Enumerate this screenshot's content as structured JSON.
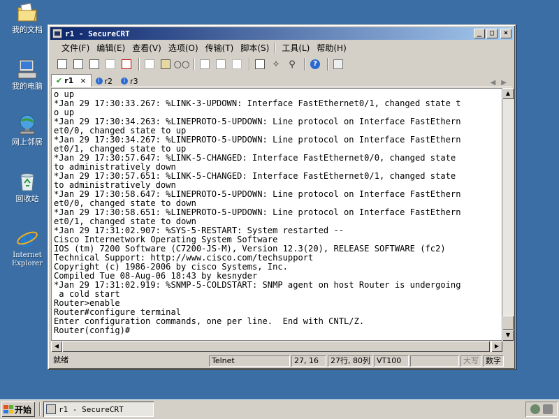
{
  "desktop": {
    "icons": [
      {
        "label": "我的文档",
        "icon": "my-documents-folder-icon"
      },
      {
        "label": "我的电脑",
        "icon": "my-computer-icon"
      },
      {
        "label": "网上邻居",
        "icon": "network-places-icon"
      },
      {
        "label": "回收站",
        "icon": "recycle-bin-icon"
      },
      {
        "label": "Internet Explorer",
        "icon": "internet-explorer-icon"
      }
    ]
  },
  "window": {
    "title": "r1 - SecureCRT",
    "controls": {
      "minimize": "_",
      "maximize": "□",
      "close": "×"
    }
  },
  "menu": [
    "文件(F)",
    "编辑(E)",
    "查看(V)",
    "选项(O)",
    "传输(T)",
    "脚本(S)",
    "工具(L)",
    "帮助(H)"
  ],
  "toolbar_icons": [
    "connect-icon",
    "quick-connect-icon",
    "connect-in-tab-icon",
    "reconnect-icon",
    "disconnect-icon",
    "copy-icon",
    "paste-icon",
    "find-icon",
    "print-icon",
    "print-selection-icon",
    "print-setup-icon",
    "session-options-icon",
    "global-options-icon",
    "key-generator-icon",
    "help-icon",
    "map-keys-icon"
  ],
  "tabs": [
    {
      "label": "r1",
      "status": "connected",
      "active": true,
      "close": "×"
    },
    {
      "label": "r2",
      "status": "info",
      "active": false
    },
    {
      "label": "r3",
      "status": "info",
      "active": false
    }
  ],
  "terminal": {
    "lines": [
      "o up",
      "*Jan 29 17:30:33.267: %LINK-3-UPDOWN: Interface FastEthernet0/1, changed state t",
      "o up",
      "*Jan 29 17:30:34.263: %LINEPROTO-5-UPDOWN: Line protocol on Interface FastEthern",
      "et0/0, changed state to up",
      "*Jan 29 17:30:34.267: %LINEPROTO-5-UPDOWN: Line protocol on Interface FastEthern",
      "et0/1, changed state to up",
      "*Jan 29 17:30:57.647: %LINK-5-CHANGED: Interface FastEthernet0/0, changed state",
      "to administratively down",
      "*Jan 29 17:30:57.651: %LINK-5-CHANGED: Interface FastEthernet0/1, changed state",
      "to administratively down",
      "*Jan 29 17:30:58.647: %LINEPROTO-5-UPDOWN: Line protocol on Interface FastEthern",
      "et0/0, changed state to down",
      "*Jan 29 17:30:58.651: %LINEPROTO-5-UPDOWN: Line protocol on Interface FastEthern",
      "et0/1, changed state to down",
      "*Jan 29 17:31:02.907: %SYS-5-RESTART: System restarted --",
      "Cisco Internetwork Operating System Software",
      "IOS (tm) 7200 Software (C7200-JS-M), Version 12.3(20), RELEASE SOFTWARE (fc2)",
      "Technical Support: http://www.cisco.com/techsupport",
      "Copyright (c) 1986-2006 by cisco Systems, Inc.",
      "Compiled Tue 08-Aug-06 18:43 by kesnyder",
      "*Jan 29 17:31:02.919: %SNMP-5-COLDSTART: SNMP agent on host Router is undergoing",
      " a cold start",
      "Router>enable",
      "Router#configure terminal",
      "Enter configuration commands, one per line.  End with CNTL/Z.",
      "Router(config)#"
    ]
  },
  "statusbar": {
    "ready": "就绪",
    "protocol": "Telnet",
    "cursor": "27, 16",
    "size": "27行, 80列",
    "emulation": "VT100",
    "blank": "",
    "caps": "大写",
    "num": "数字"
  },
  "taskbar": {
    "start": "开始",
    "task": "r1 - SecureCRT"
  }
}
